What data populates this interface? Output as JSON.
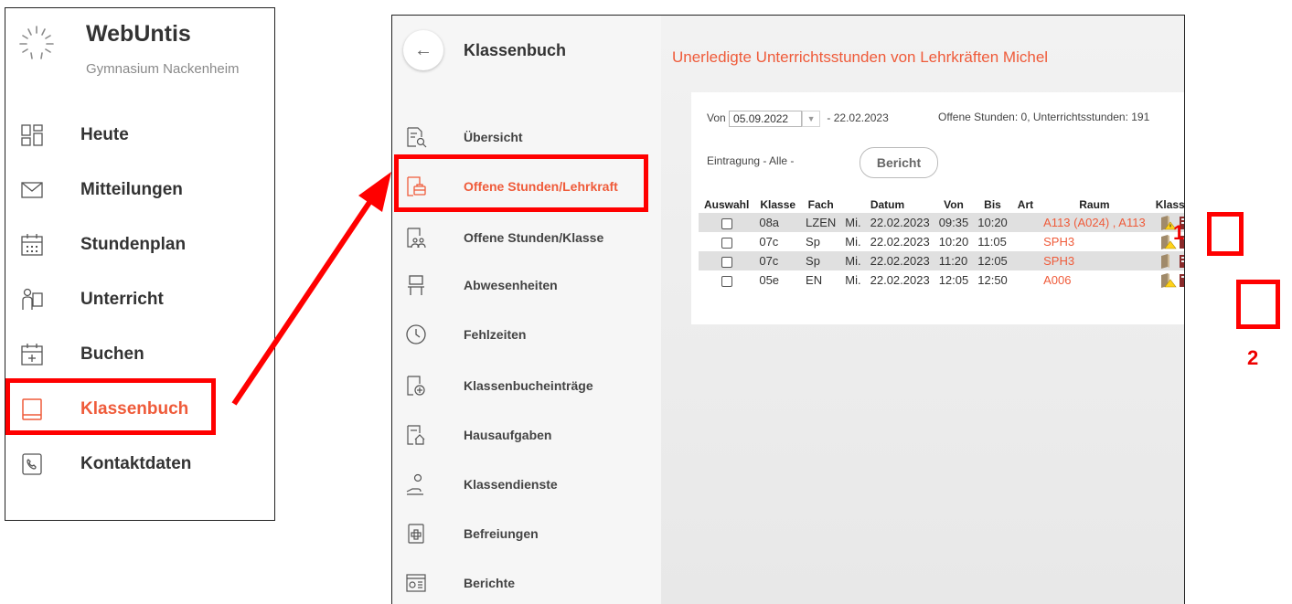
{
  "app": {
    "title": "WebUntis",
    "school": "Gymnasium Nackenheim"
  },
  "main_nav": {
    "items": [
      {
        "label": "Heute",
        "icon": "dashboard-icon"
      },
      {
        "label": "Mitteilungen",
        "icon": "envelope-icon"
      },
      {
        "label": "Stundenplan",
        "icon": "calendar-grid-icon"
      },
      {
        "label": "Unterricht",
        "icon": "teacher-icon"
      },
      {
        "label": "Buchen",
        "icon": "calendar-plus-icon"
      },
      {
        "label": "Klassenbuch",
        "icon": "book-icon",
        "active": true
      },
      {
        "label": "Kontaktdaten",
        "icon": "contact-card-icon"
      }
    ]
  },
  "submenu": {
    "title": "Klassenbuch",
    "back_icon": "arrow-left-icon",
    "items": [
      {
        "label": "Übersicht",
        "icon": "document-search-icon"
      },
      {
        "label": "Offene Stunden/Lehrkraft",
        "icon": "briefcase-doc-icon",
        "active": true
      },
      {
        "label": "Offene Stunden/Klasse",
        "icon": "group-doc-icon"
      },
      {
        "label": "Abwesenheiten",
        "icon": "chair-icon"
      },
      {
        "label": "Fehlzeiten",
        "icon": "clock-icon"
      },
      {
        "label": "Klassenbucheinträge",
        "icon": "doc-plus-icon"
      },
      {
        "label": "Hausaufgaben",
        "icon": "doc-home-icon"
      },
      {
        "label": "Klassendienste",
        "icon": "person-service-icon"
      },
      {
        "label": "Befreiungen",
        "icon": "medical-doc-icon"
      },
      {
        "label": "Berichte",
        "icon": "report-icon"
      }
    ]
  },
  "content": {
    "heading": "Unerledigte Unterrichtsstunden von Lehrkräften Michel",
    "filter": {
      "von_label": "Von",
      "from_date": "05.09.2022",
      "to_date": "- 22.02.2023",
      "stats": "Offene Stunden: 0, Unterrichtsstunden: 191",
      "eintragung": "Eintragung - Alle -",
      "bericht_button": "Bericht"
    },
    "table": {
      "headers": [
        "Auswahl",
        "Klasse",
        "Fach",
        "Datum",
        "Von",
        "Bis",
        "Art",
        "Raum",
        "Klassenbuch"
      ],
      "rows": [
        {
          "klasse": "08a",
          "fach": "LZEN",
          "tag": "Mi.",
          "datum": "22.02.2023",
          "von": "09:35",
          "bis": "10:20",
          "art": "",
          "raum": "A113 (A024) , A113"
        },
        {
          "klasse": "07c",
          "fach": "Sp",
          "tag": "Mi.",
          "datum": "22.02.2023",
          "von": "10:20",
          "bis": "11:05",
          "art": "",
          "raum": "SPH3"
        },
        {
          "klasse": "07c",
          "fach": "Sp",
          "tag": "Mi.",
          "datum": "22.02.2023",
          "von": "11:20",
          "bis": "12:05",
          "art": "",
          "raum": "SPH3"
        },
        {
          "klasse": "05e",
          "fach": "EN",
          "tag": "Mi.",
          "datum": "22.02.2023",
          "von": "12:05",
          "bis": "12:50",
          "art": "",
          "raum": "A006"
        }
      ]
    }
  },
  "annotations": {
    "label1": "1",
    "label2": "2"
  },
  "colors": {
    "accent": "#ef5b3a",
    "annotation": "#ff0000"
  }
}
